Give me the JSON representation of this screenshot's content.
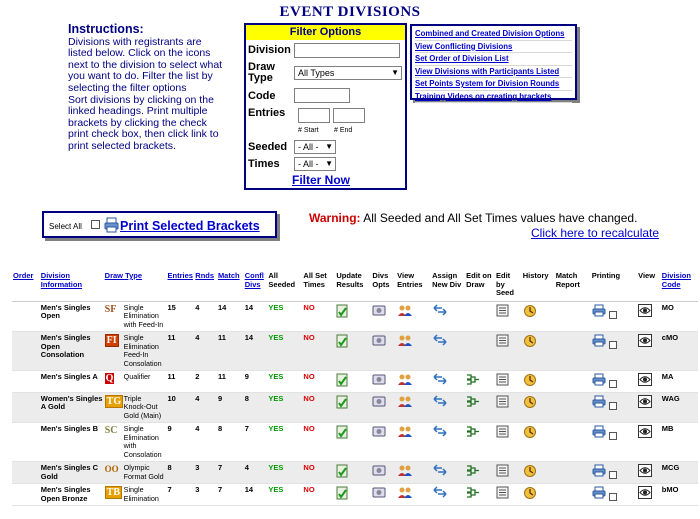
{
  "page": {
    "title": "EVENT DIVISIONS"
  },
  "instructions": {
    "heading": "Instructions:",
    "lines": [
      "Divisions with registrants are",
      "listed below. Click on the icons",
      "next to the division to select what",
      "you want to do. Filter the list by",
      "selecting the filter options",
      "Sort divisions by clicking on the",
      "linked headings. Print multiple",
      "brackets by clicking the check",
      "print check box, then click link to",
      "print selected brackets."
    ]
  },
  "filter": {
    "title": "Filter Options",
    "division_label": "Division",
    "division_value": "",
    "draw_type_label_1": "Draw",
    "draw_type_label_2": "Type",
    "draw_type_value": "All Types",
    "code_label": "Code",
    "code_value": "",
    "entries_label": "Entries",
    "entries_start_value": "",
    "entries_end_value": "",
    "start_hint": "# Start",
    "end_hint": "# End",
    "seeded_label": "Seeded",
    "seeded_value": "- All -",
    "times_label": "Times",
    "times_value": "- All -",
    "filter_button": "Filter Now"
  },
  "links": [
    "Combined and Created Division Options",
    "View Conflicting Divisions",
    "Set Order of Division List",
    "View Divisions with Participants Listed",
    "Set Points System for Division Rounds",
    "Training Videos on creating brackets"
  ],
  "print_bar": {
    "select_all_label": "Select All",
    "print_link": "Print Selected Brackets"
  },
  "warning": {
    "label": "Warning:",
    "message": "All Seeded and All Set Times values have changed.",
    "recalc_link": "Click here to recalculate"
  },
  "table": {
    "headers": {
      "order": "Order",
      "division": "Division Information",
      "draw_type": "Draw Type",
      "entries": "Entries",
      "rnds": "Rnds",
      "match": "Match",
      "confl": "Confl Divs",
      "all_seeded": "All Seeded",
      "all_set_times": "All Set Times",
      "update_results": "Update Results",
      "divs_opts": "Divs Opts",
      "view_entries": "View Entries",
      "assign_new_div": "Assign New Div",
      "edit_on_draw": "Edit on Draw",
      "edit_by_seed": "Edit by Seed",
      "history": "History",
      "match_report": "Match Report",
      "printing": "Printing",
      "view": "View",
      "division_code": "Division Code"
    },
    "rows": [
      {
        "division": "Men's Singles Open",
        "draw_code": "SF",
        "draw_style": "plain",
        "draw_name": "Single Elimination with Feed-In",
        "entries": "15",
        "rnds": "4",
        "match": "14",
        "confl": "14",
        "all_seeded": "YES",
        "all_set_times": "NO",
        "edit_on_draw": false,
        "code": "MO"
      },
      {
        "division": "Men's Singles Open Consolation",
        "draw_code": "FI",
        "draw_style": "boxed",
        "draw_name": "Single Elimination Feed-In Consolation",
        "entries": "11",
        "rnds": "4",
        "match": "11",
        "confl": "14",
        "all_seeded": "YES",
        "all_set_times": "NO",
        "edit_on_draw": false,
        "code": "cMO"
      },
      {
        "division": "Men's Singles A",
        "draw_code": "Q",
        "draw_style": "q",
        "draw_name": "Qualifier",
        "entries": "11",
        "rnds": "2",
        "match": "11",
        "confl": "9",
        "all_seeded": "YES",
        "all_set_times": "NO",
        "edit_on_draw": true,
        "code": "MA"
      },
      {
        "division": "Women's Singles A Gold",
        "draw_code": "TG",
        "draw_style": "boxed-y",
        "draw_name": "Triple Knock-Out Gold (Main)",
        "entries": "10",
        "rnds": "4",
        "match": "9",
        "confl": "8",
        "all_seeded": "YES",
        "all_set_times": "NO",
        "edit_on_draw": true,
        "code": "WAG"
      },
      {
        "division": "Men's Singles B",
        "draw_code": "SC",
        "draw_style": "plain-g",
        "draw_name": "Single Elimination with Consolation",
        "entries": "9",
        "rnds": "4",
        "match": "8",
        "confl": "7",
        "all_seeded": "YES",
        "all_set_times": "NO",
        "edit_on_draw": true,
        "code": "MB"
      },
      {
        "division": "Men's Singles C Gold",
        "draw_code": "OO",
        "draw_style": "circ",
        "draw_name": "Olympic Format Gold",
        "entries": "8",
        "rnds": "3",
        "match": "7",
        "confl": "4",
        "all_seeded": "YES",
        "all_set_times": "NO",
        "edit_on_draw": true,
        "code": "MCG"
      },
      {
        "division": "Men's Singles Open Bronze",
        "draw_code": "TB",
        "draw_style": "boxed-y",
        "draw_name": "Single Elimination",
        "entries": "7",
        "rnds": "3",
        "match": "7",
        "confl": "14",
        "all_seeded": "YES",
        "all_set_times": "NO",
        "edit_on_draw": true,
        "code": "bMO"
      }
    ]
  },
  "colors": {
    "link": "#0000cc",
    "navy": "#000080",
    "yes": "#009900",
    "no": "#dd0000",
    "warning": "#cc0000",
    "filter_title_bg": "#ffff00"
  },
  "icons": {
    "update_results": "update-results-icon",
    "divs_opts": "division-options-icon",
    "view_entries": "people-icon",
    "assign_new_div": "move-arrows-icon",
    "edit_on_draw": "bracket-draw-icon",
    "edit_by_seed": "seed-edit-icon",
    "history": "history-icon",
    "printing": "printer-icon",
    "view": "eye-icon"
  }
}
